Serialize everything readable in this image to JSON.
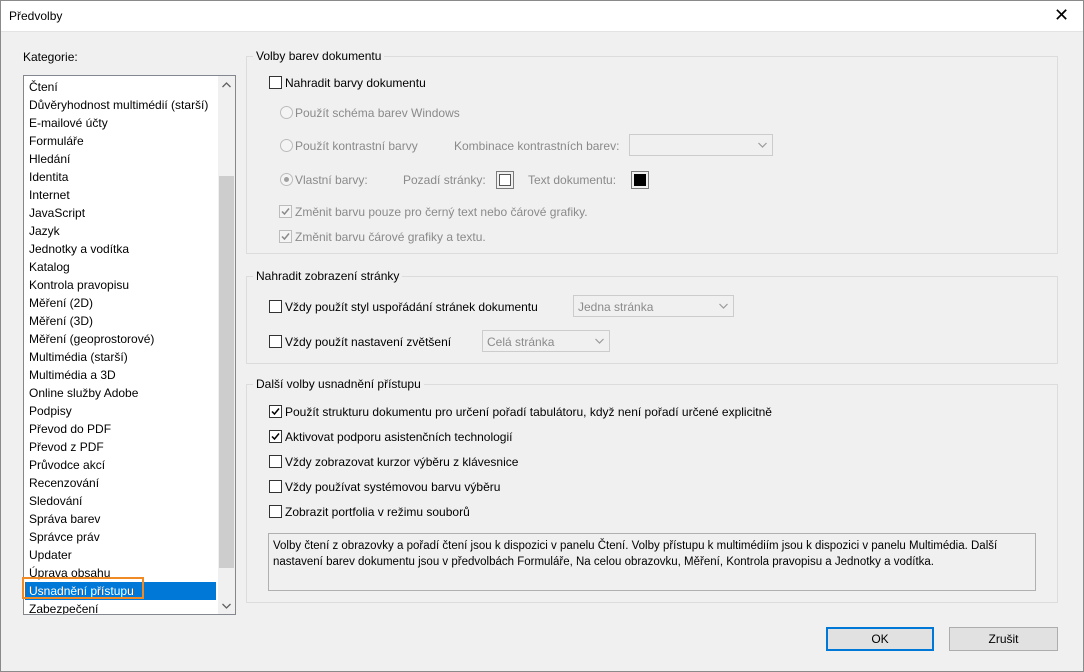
{
  "window": {
    "title": "Předvolby",
    "close_glyph": "✕"
  },
  "categories": {
    "label": "Kategorie:",
    "selected_index": 28,
    "items": [
      "Čtení",
      "Důvěryhodnost multimédií (starší)",
      "E-mailové účty",
      "Formuláře",
      "Hledání",
      "Identita",
      "Internet",
      "JavaScript",
      "Jazyk",
      "Jednotky a vodítka",
      "Katalog",
      "Kontrola pravopisu",
      "Měření (2D)",
      "Měření (3D)",
      "Měření (geoprostorové)",
      "Multimédia (starší)",
      "Multimédia a 3D",
      "Online služby Adobe",
      "Podpisy",
      "Převod do PDF",
      "Převod z PDF",
      "Průvodce akcí",
      "Recenzování",
      "Sledování",
      "Správa barev",
      "Správce práv",
      "Updater",
      "Úprava obsahu",
      "Usnadnění přístupu",
      "Zabezpečení"
    ]
  },
  "doc_colors": {
    "title": "Volby barev dokumentu",
    "replace_colors": {
      "label": "Nahradit barvy dokumentu",
      "checked": false
    },
    "windows_scheme": {
      "label": "Použít schéma barev Windows"
    },
    "high_contrast": {
      "label": "Použít kontrastní barvy",
      "combo_label": "Kombinace kontrastních barev:",
      "combo_value": ""
    },
    "custom_colors": {
      "label": "Vlastní barvy:",
      "page_bg_label": "Pozadí stránky:",
      "page_bg_color": "#ffffff",
      "doc_text_label": "Text dokumentu:",
      "doc_text_color": "#000000"
    },
    "only_black_text": {
      "label": "Změnit barvu pouze pro černý text nebo čárové grafiky.",
      "checked": true
    },
    "line_art": {
      "label": "Změnit barvu čárové grafiky a textu.",
      "checked": true
    }
  },
  "page_display": {
    "title": "Nahradit zobrazení stránky",
    "layout_style": {
      "label": "Vždy použít styl uspořádání stránek dokumentu",
      "checked": false,
      "value": "Jedna stránka"
    },
    "zoom": {
      "label": "Vždy použít nastavení zvětšení",
      "checked": false,
      "value": "Celá stránka"
    }
  },
  "accessibility": {
    "title": "Další volby usnadnění přístupu",
    "options": [
      {
        "label": "Použít strukturu dokumentu pro určení pořadí tabulátoru, když není pořadí určené explicitně",
        "checked": true
      },
      {
        "label": "Aktivovat podporu asistenčních technologií",
        "checked": true
      },
      {
        "label": "Vždy zobrazovat kurzor výběru z klávesnice",
        "checked": false
      },
      {
        "label": "Vždy používat systémovou barvu výběru",
        "checked": false
      },
      {
        "label": "Zobrazit portfolia v režimu souborů",
        "checked": false
      }
    ],
    "description": "Volby čtení z obrazovky a pořadí čtení jsou k dispozici v panelu Čtení. Volby přístupu k multimédiím jsou k dispozici v panelu Multimédia. Další nastavení barev dokumentu jsou v předvolbách Formuláře, Na celou obrazovku, Měření, Kontrola pravopisu a Jednotky a vodítka."
  },
  "buttons": {
    "ok": "OK",
    "cancel": "Zrušit"
  },
  "colors": {
    "selection": "#0078d7",
    "highlight": "#f08a24",
    "default_button_border": "#0078d7"
  }
}
